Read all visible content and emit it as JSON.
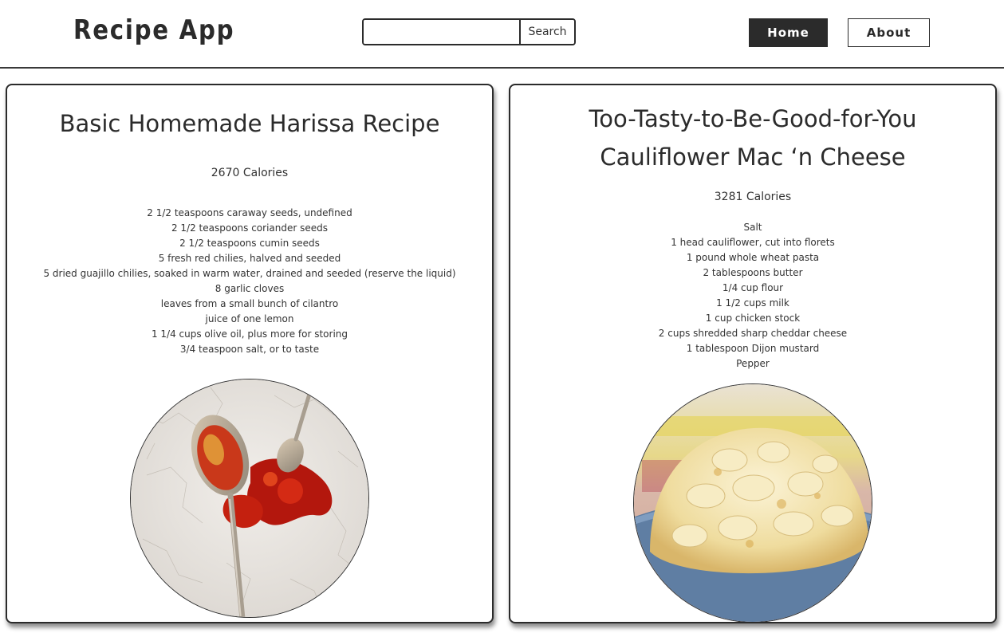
{
  "header": {
    "logo": "Recipe App",
    "search_placeholder": "",
    "search_button": "Search",
    "nav": {
      "home": "Home",
      "about": "About"
    }
  },
  "recipes": [
    {
      "title": "Basic Homemade Harissa Recipe",
      "calories": "2670 Calories",
      "ingredients": [
        "2 1/2 teaspoons caraway seeds, undefined",
        "2 1/2 teaspoons coriander seeds",
        "2 1/2 teaspoons cumin seeds",
        "5 fresh red chilies, halved and seeded",
        "5 dried guajillo chilies, soaked in warm water, drained and seeded (reserve the liquid)",
        "8 garlic cloves",
        "leaves from a small bunch of cilantro",
        "juice of one lemon",
        "1 1/4 cups olive oil, plus more for storing",
        "3/4 teaspoon salt, or to taste"
      ],
      "image_subject": "harissa-spoons-photo"
    },
    {
      "title": "Too-Tasty-to-Be-Good-for-You Cauliflower Mac ‘n Cheese",
      "calories": "3281 Calories",
      "ingredients": [
        "Salt",
        "1 head cauliflower, cut into florets",
        "1 pound whole wheat pasta",
        "2 tablespoons butter",
        "1/4 cup flour",
        "1 1/2 cups milk",
        "1 cup chicken stock",
        "2 cups shredded sharp cheddar cheese",
        "1 tablespoon Dijon mustard",
        "Pepper"
      ],
      "image_subject": "mac-and-cheese-bowl-photo"
    }
  ],
  "colors": {
    "primary": "#2b2b2b",
    "background": "#ffffff"
  }
}
